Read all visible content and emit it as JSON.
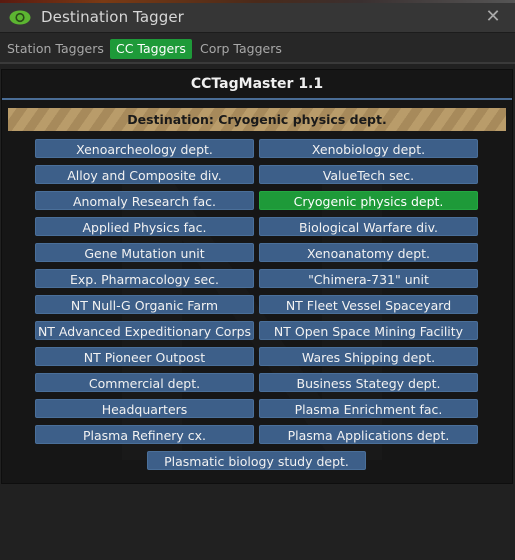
{
  "window": {
    "title": "Destination Tagger",
    "icon": "eye-icon",
    "close_label": "✕",
    "colors": {
      "titlebar": "#363636",
      "eye_icon": "#5cb531"
    }
  },
  "tabs": [
    {
      "label": "Station Taggers",
      "active": false
    },
    {
      "label": "CC Taggers",
      "active": true
    },
    {
      "label": "Corp Taggers",
      "active": false
    }
  ],
  "panel": {
    "title": "CCTagMaster 1.1",
    "destination_text": "Destination: Cryogenic physics dept.",
    "selected": "Cryogenic physics dept.",
    "colors": {
      "button": "#3d5f89",
      "selected_button": "#1e9a39",
      "accent_rule": "#4a6d96",
      "destination_bar": "#b99c6a"
    },
    "destinations": [
      "Xenoarcheology dept.",
      "Xenobiology dept.",
      "Alloy and Composite div.",
      "ValueTech sec.",
      "Anomaly Research fac.",
      "Cryogenic physics dept.",
      "Applied Physics fac.",
      "Biological Warfare div.",
      "Gene Mutation unit",
      "Xenoanatomy dept.",
      "Exp. Pharmacology sec.",
      "\"Chimera-731\" unit",
      "NT Null-G Organic Farm",
      "NT Fleet Vessel Spaceyard",
      "NT Advanced Expeditionary Corps",
      "NT Open Space Mining Facility",
      "NT Pioneer Outpost",
      "Wares Shipping dept.",
      "Commercial dept.",
      "Business Stategy dept.",
      "Headquarters",
      "Plasma Enrichment fac.",
      "Plasma Refinery cx.",
      "Plasma Applications dept.",
      "Plasmatic biology study dept."
    ]
  }
}
